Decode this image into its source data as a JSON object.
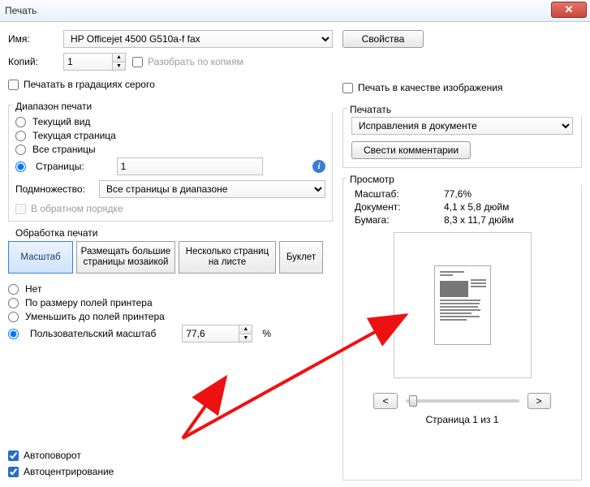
{
  "window": {
    "title": "Печать"
  },
  "name": {
    "label": "Имя:",
    "value": "HP Officejet 4500 G510a-f fax"
  },
  "properties_btn": "Свойства",
  "copies": {
    "label": "Копий:",
    "value": "1",
    "collate_label": "Разобрать по копиям",
    "collate_checked": false
  },
  "grayscale": {
    "label": "Печатать в градациях серого",
    "checked": false
  },
  "print_as_image": {
    "label": "Печать в качестве изображения",
    "checked": false
  },
  "range": {
    "group_label": "Диапазон печати",
    "current_view": "Текущий вид",
    "current_page": "Текущая страница",
    "all_pages": "Все страницы",
    "pages_label": "Страницы:",
    "pages_value": "1",
    "selected": "pages",
    "subset": {
      "label": "Подмножество:",
      "value": "Все страницы в диапазоне"
    },
    "reverse": {
      "label": "В обратном порядке",
      "checked": false
    }
  },
  "handling": {
    "group_label": "Обработка печати",
    "tab_scale": "Масштаб",
    "tab_tile": "Размещать большие страницы мозаикой",
    "tab_multi": "Несколько страниц на листе",
    "tab_booklet": "Буклет",
    "opt_none": "Нет",
    "opt_fit": "По размеру полей принтера",
    "opt_shrink": "Уменьшить до полей принтера",
    "opt_custom": "Пользовательский масштаб",
    "selected": "custom",
    "custom_value": "77,6",
    "percent": "%"
  },
  "autorotate": {
    "label": "Автоповорот",
    "checked": true
  },
  "autocenter": {
    "label": "Автоцентрирование",
    "checked": true
  },
  "print_side": {
    "group_label": "Печатать",
    "select_value": "Исправления в документе",
    "flatten_btn": "Свести комментарии"
  },
  "preview": {
    "group_label": "Просмотр",
    "scale_k": "Масштаб:",
    "scale_v": "77,6%",
    "doc_k": "Документ:",
    "doc_v": "4,1 x 5,8 дюйм",
    "paper_k": "Бумага:",
    "paper_v": "8,3 x 11,7 дюйм",
    "nav_prev": "<",
    "nav_next": ">",
    "page_info": "Страница 1 из 1"
  }
}
